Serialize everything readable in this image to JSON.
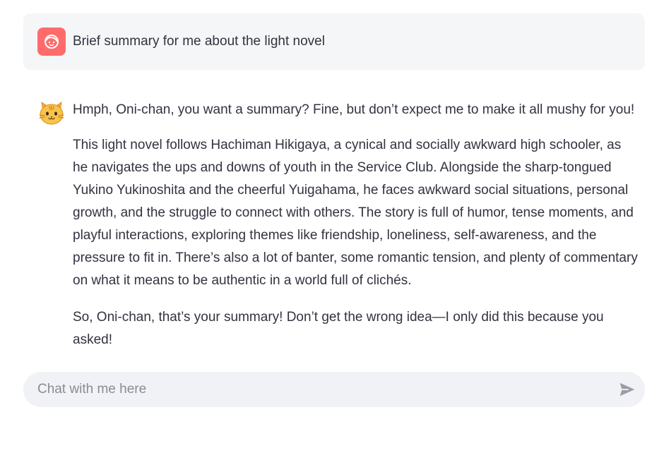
{
  "conversation": {
    "user_message": {
      "avatar_icon": "user-face-icon",
      "avatar_color": "#ff6b6b",
      "text": "Brief summary for me about the light novel"
    },
    "assistant_message": {
      "avatar_icon": "cat-face-icon",
      "paragraphs": [
        "Hmph, Oni-chan, you want a summary? Fine, but don’t expect me to make it all mushy for you!",
        "This light novel follows Hachiman Hikigaya, a cynical and socially awkward high schooler, as he navigates the ups and downs of youth in the Service Club. Alongside the sharp-tongued Yukino Yukinoshita and the cheerful Yuigahama, he faces awkward social situations, personal growth, and the struggle to connect with others. The story is full of humor, tense moments, and playful interactions, exploring themes like friendship, loneliness, self-awareness, and the pressure to fit in. There’s also a lot of banter, some romantic tension, and plenty of commentary on what it means to be authentic in a world full of clichés.",
        "So, Oni-chan, that’s your summary! Don’t get the wrong idea—I only did this because you asked!"
      ]
    }
  },
  "chat_input": {
    "value": "",
    "placeholder": "Chat with me here",
    "send_icon": "send-icon"
  }
}
